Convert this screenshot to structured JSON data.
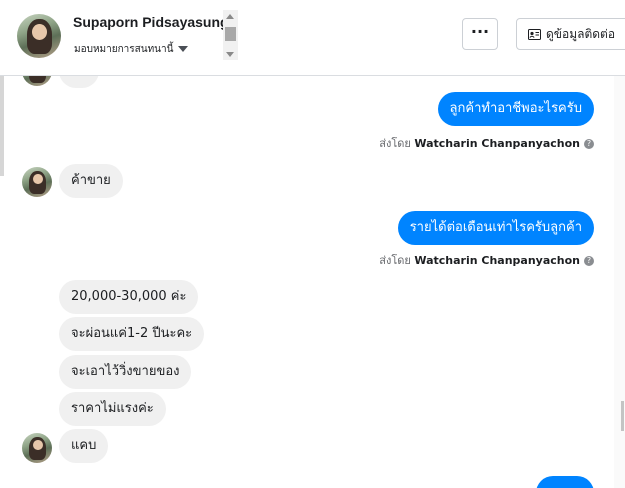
{
  "header": {
    "name": "Supaporn Pidsayasung",
    "subtitle": "มอบหมายการสนทนานี้",
    "more_label": "···",
    "contact_label": "ดูข้อมูลติดต่อ"
  },
  "messages": [
    {
      "dir": "out",
      "text": "ลูกค้าทำอาชีพอะไรครับ"
    },
    {
      "dir": "sentby",
      "prefix": "ส่งโดย",
      "author": "Watcharin Chanpanyachon"
    },
    {
      "dir": "in",
      "text": "ค้าขาย"
    },
    {
      "dir": "out",
      "text": "รายได้ต่อเดือนเท่าไรครับลูกค้า"
    },
    {
      "dir": "sentby",
      "prefix": "ส่งโดย",
      "author": "Watcharin Chanpanyachon"
    },
    {
      "dir": "in",
      "text": "20,000-30,000 ค่ะ"
    },
    {
      "dir": "in",
      "text": "จะผ่อนแค่1-2 ปีนะคะ"
    },
    {
      "dir": "in",
      "text": "จะเอาไว้วิ่งขายของ"
    },
    {
      "dir": "in",
      "text": "ราคาไม่แรงค่ะ"
    },
    {
      "dir": "in",
      "text": "แคบ"
    }
  ],
  "colors": {
    "accent": "#0084ff",
    "incoming": "#f0f0f0"
  }
}
